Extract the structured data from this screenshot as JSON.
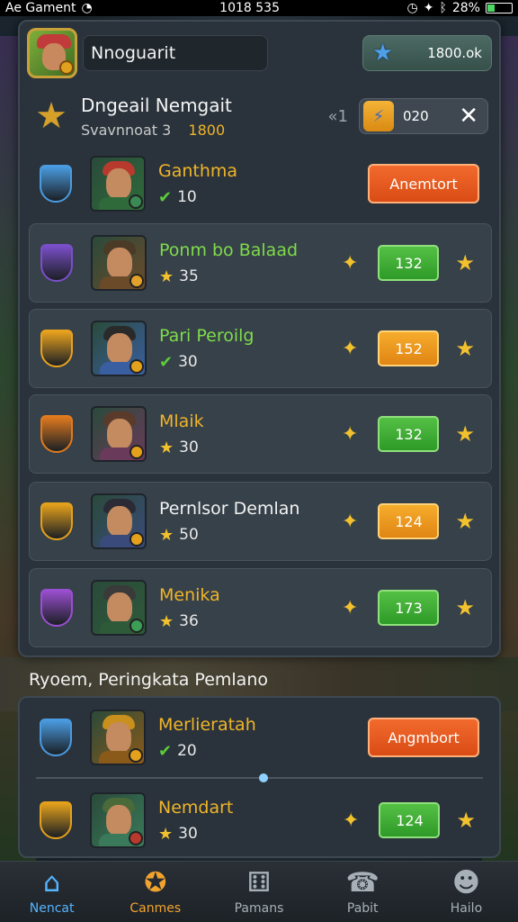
{
  "status_bar": {
    "carrier": "Ae Gament",
    "time": "1018 535",
    "battery": "28%"
  },
  "header": {
    "player_name": "Nnoguarit",
    "currency_value": "1800.ok"
  },
  "section": {
    "title": "Dngeail Nemgait",
    "subtitle": "Svavnnoat 3",
    "value": "1800",
    "chevron": "«1",
    "counter_value": "020"
  },
  "leaderboard": [
    {
      "name": "Ganthma",
      "score": "10",
      "action": "Anemtort",
      "score_icon": "check-icon",
      "color": "#f0b429",
      "rank_color": "#4a9be0"
    },
    {
      "name": "Ponm bo Balaad",
      "score": "35",
      "value": "132",
      "value_color": "green",
      "score_icon": "star-icon",
      "color": "#7fdc4a",
      "rank_color": "#7a4fc9"
    },
    {
      "name": "Pari Peroilg",
      "score": "30",
      "value": "152",
      "value_color": "orange",
      "score_icon": "check-icon",
      "color": "#7fdc4a",
      "rank_color": "#e9a21e"
    },
    {
      "name": "Mlaik",
      "score": "30",
      "value": "132",
      "value_color": "green",
      "score_icon": "star-icon",
      "color": "#f0b429",
      "rank_color": "#e07a1e"
    },
    {
      "name": "Pernlsor Demlan",
      "score": "50",
      "value": "124",
      "value_color": "orange",
      "score_icon": "star-icon",
      "color": "#f2f2f2",
      "rank_color": "#e5a11c"
    },
    {
      "name": "Menika",
      "score": "36",
      "value": "173",
      "value_color": "green",
      "score_icon": "star-icon",
      "color": "#f0b429",
      "rank_color": "#9a4fd0"
    }
  ],
  "section2": {
    "title": "Ryoem, Peringkata Pemlano",
    "rows": [
      {
        "name": "Merlieratah",
        "score": "20",
        "action": "Angmbort",
        "score_icon": "check-icon",
        "color": "#f0b429",
        "rank_color": "#4a9be0"
      },
      {
        "name": "Nemdart",
        "score": "30",
        "value": "124",
        "value_color": "green",
        "score_icon": "star-icon",
        "color": "#f0b429",
        "rank_color": "#e5a11c"
      }
    ]
  },
  "bottom_nav": [
    {
      "label": "Nencat",
      "icon": "home-icon"
    },
    {
      "label": "Canmes",
      "icon": "games-icon"
    },
    {
      "label": "Pamans",
      "icon": "dice-icon"
    },
    {
      "label": "Pabit",
      "icon": "chat-icon"
    },
    {
      "label": "Hailo",
      "icon": "profile-icon"
    }
  ]
}
